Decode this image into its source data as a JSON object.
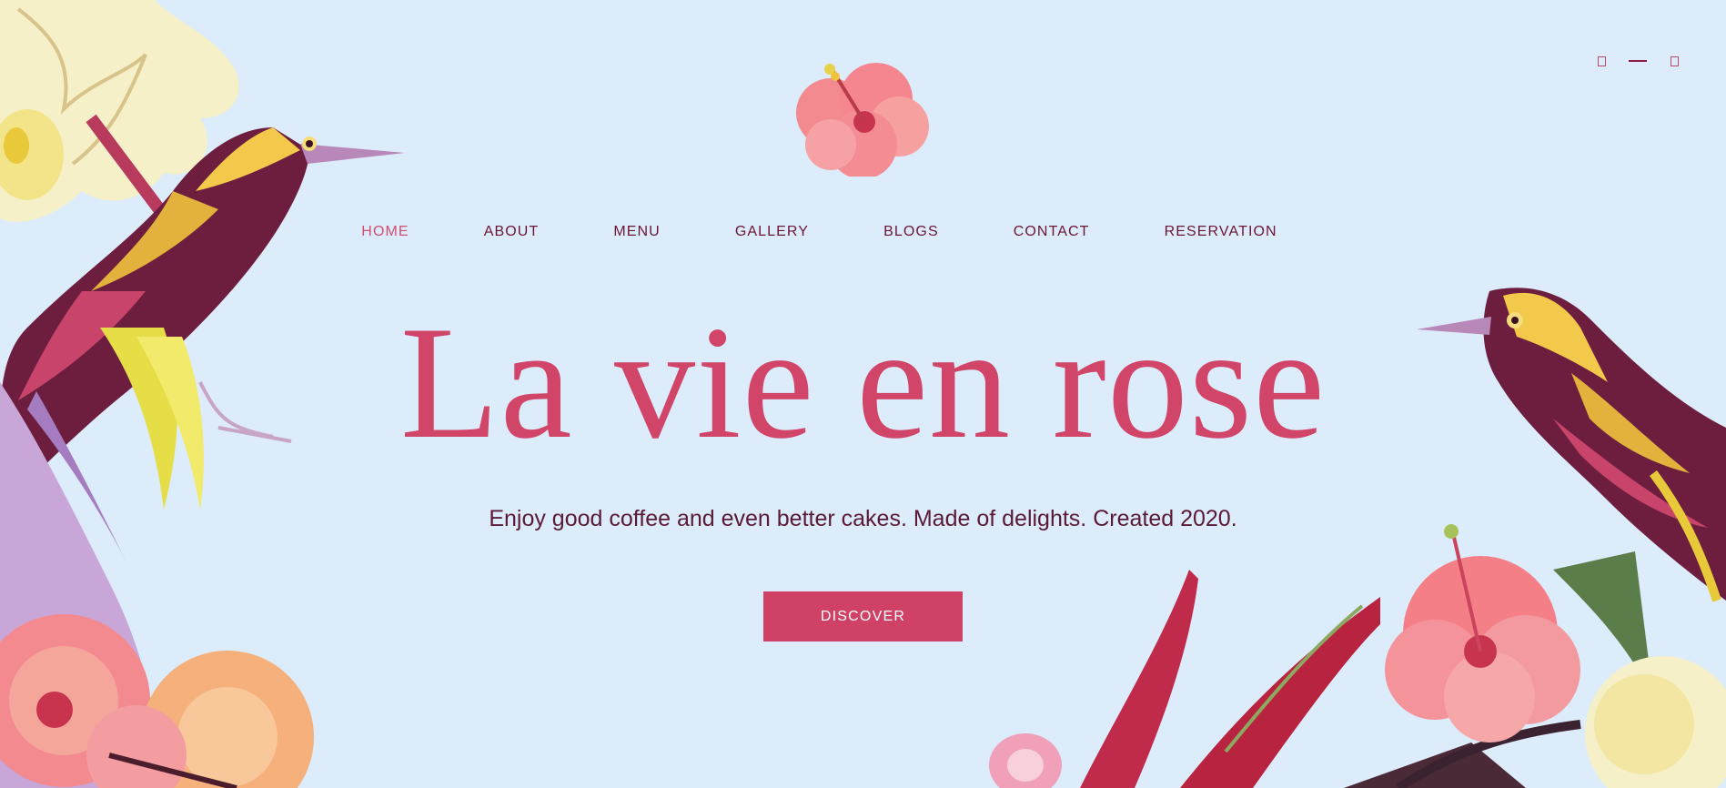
{
  "header": {
    "icons": [
      {
        "name": "square-icon"
      },
      {
        "name": "minus-icon"
      },
      {
        "name": "square-icon"
      }
    ]
  },
  "nav": {
    "items": [
      {
        "label": "HOME",
        "active": true
      },
      {
        "label": "ABOUT",
        "active": false
      },
      {
        "label": "MENU",
        "active": false
      },
      {
        "label": "GALLERY",
        "active": false
      },
      {
        "label": "BLOGS",
        "active": false
      },
      {
        "label": "CONTACT",
        "active": false
      },
      {
        "label": "RESERVATION",
        "active": false
      }
    ]
  },
  "hero": {
    "title": "La vie en rose",
    "subtitle": "Enjoy good coffee and even better cakes. Made of delights. Created 2020.",
    "cta_label": "DISCOVER"
  },
  "colors": {
    "background": "#dcecfb",
    "accent": "#cf4266",
    "nav_text": "#6b1535",
    "nav_active": "#cf4f73",
    "subtitle_text": "#5a1a36"
  }
}
